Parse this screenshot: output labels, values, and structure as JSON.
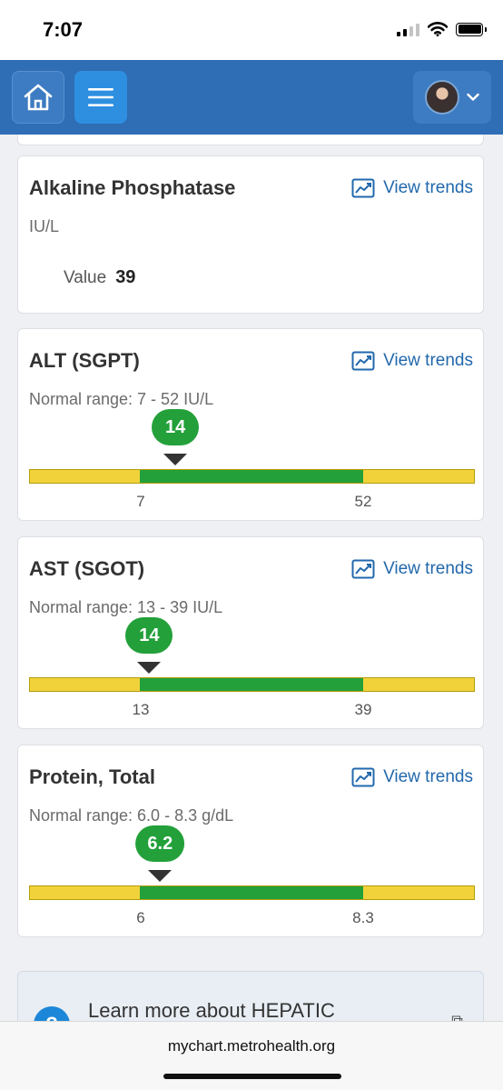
{
  "status_bar": {
    "time": "7:07"
  },
  "header": {
    "home_icon": "home-icon",
    "menu_icon": "hamburger-menu-icon",
    "account_icon": "chevron-down-icon"
  },
  "results": [
    {
      "title": "Alkaline Phosphatase",
      "unit": "IU/L",
      "value_label": "Value",
      "value": "39",
      "trends_label": "View trends"
    },
    {
      "title": "ALT (SGPT)",
      "range_text": "Normal range: 7 - 52 IU/L",
      "value": "14",
      "low_label": "7",
      "high_label": "52",
      "trends_label": "View trends",
      "value_num": 14,
      "low": 7,
      "high": 52
    },
    {
      "title": "AST (SGOT)",
      "range_text": "Normal range: 13 - 39 IU/L",
      "value": "14",
      "low_label": "13",
      "high_label": "39",
      "trends_label": "View trends",
      "value_num": 14,
      "low": 13,
      "high": 39
    },
    {
      "title": "Protein, Total",
      "range_text": "Normal range: 6.0 - 8.3 g/dL",
      "value": "6.2",
      "low_label": "6",
      "high_label": "8.3",
      "trends_label": "View trends",
      "value_num": 6.2,
      "low": 6.0,
      "high": 8.3
    }
  ],
  "learn_more": {
    "text": "Learn more about HEPATIC",
    "icon": "info-icon",
    "ext_icon": "external-link-icon"
  },
  "browser": {
    "url": "mychart.metrohealth.org"
  },
  "colors": {
    "header": "#2f6db5",
    "normal": "#23a03a",
    "out_of_range": "#f2d23b",
    "link": "#2268ad"
  }
}
